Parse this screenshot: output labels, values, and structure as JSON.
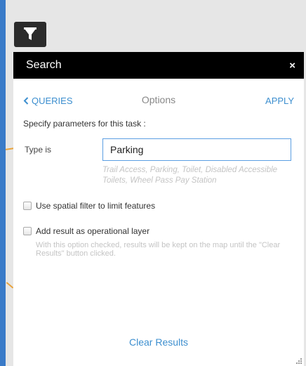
{
  "panel": {
    "title": "Search",
    "close_label": "×"
  },
  "nav": {
    "back_label": "QUERIES",
    "title": "Options",
    "apply_label": "APPLY"
  },
  "instructions": "Specify parameters for this task :",
  "parameter": {
    "label": "Type is",
    "value": "Parking",
    "hint": "Trail Access, Parking, Toilet, Disabled Accessible Toilets, Wheel Pass Pay Station"
  },
  "options": {
    "spatial_filter": {
      "label": "Use spatial filter to limit features",
      "checked": false
    },
    "operational_layer": {
      "label": "Add result as operational layer",
      "checked": false,
      "help": "With this option checked, results will be kept on the map until the \"Clear Results\" button clicked."
    }
  },
  "clear_results_label": "Clear Results",
  "icons": {
    "filter": "filter-icon",
    "back": "chevron-left-icon",
    "close": "close-icon",
    "resize": "resize-grip-icon"
  },
  "colors": {
    "header_bg": "#000000",
    "link": "#3d8fcf",
    "input_border": "#5b9ee2",
    "map_border": "#3a7bc8",
    "hint_text": "#c4c4c4"
  }
}
